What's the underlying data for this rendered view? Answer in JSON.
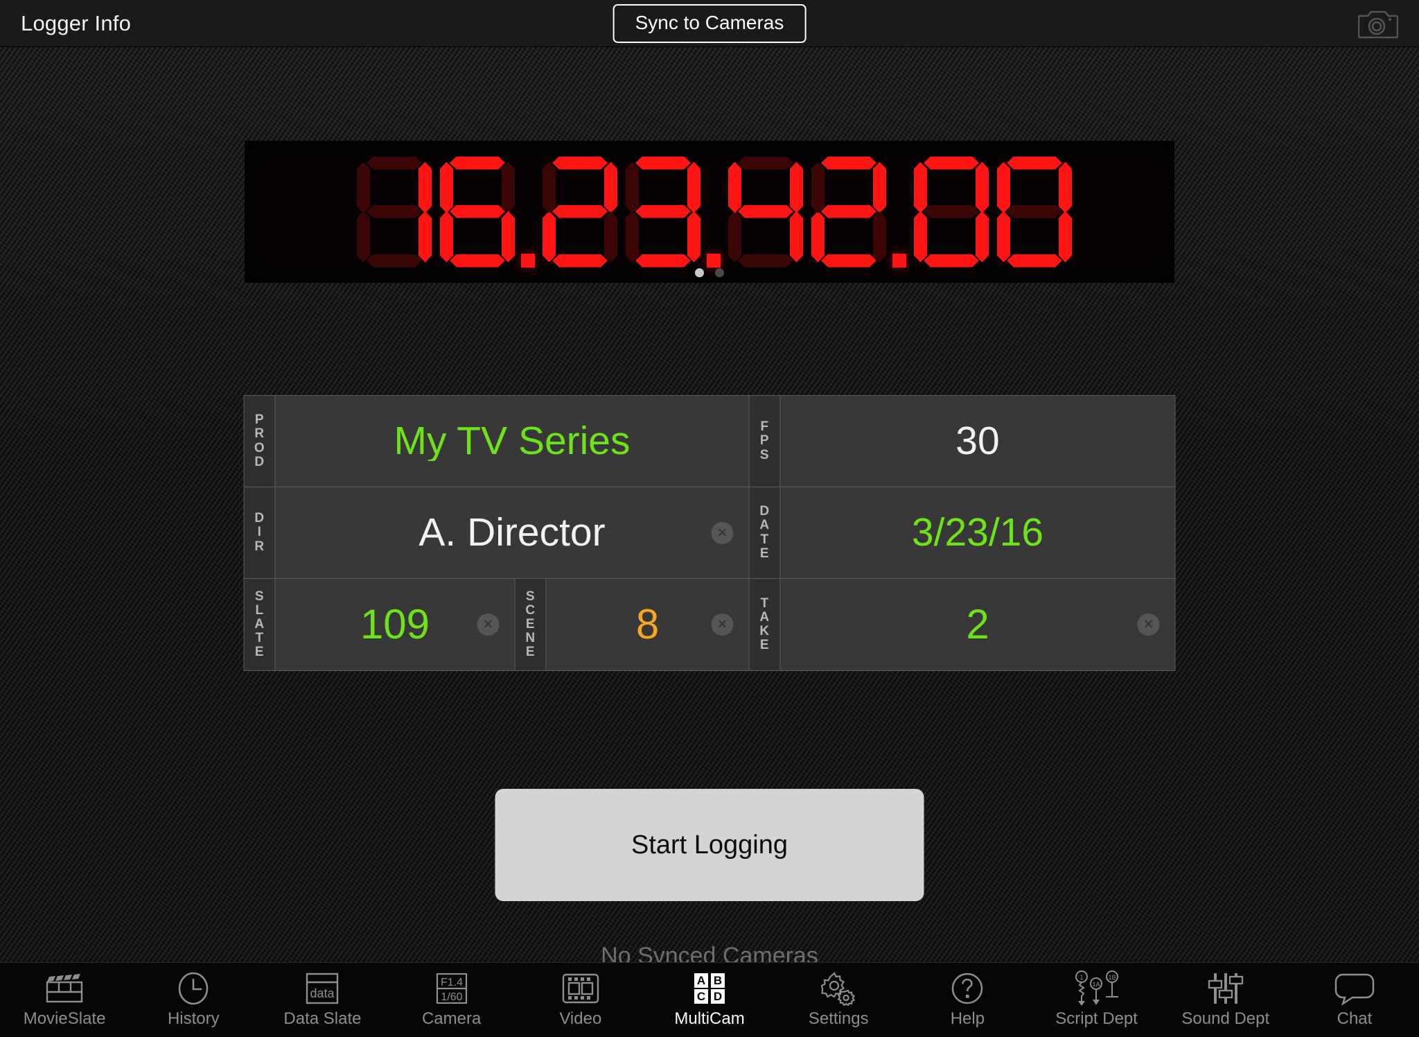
{
  "topbar": {
    "title": "Logger Info",
    "sync_button": "Sync to Cameras",
    "camera_icon": "camera-icon"
  },
  "timecode": {
    "value": "16.23.42.00",
    "digits": [
      "1",
      "6",
      ".",
      "2",
      "3",
      ".",
      "4",
      "2",
      ".",
      "0",
      "0"
    ],
    "color": "#ff1414",
    "pages": 2,
    "active_page": 1
  },
  "slate": {
    "rows": [
      {
        "left_label": "PROD",
        "left_value": "My TV Series",
        "left_color": "#6fe319",
        "left_clear": false,
        "right_label": "FPS",
        "right_value": "30",
        "right_color": "#f2f2f2",
        "right_clear": false
      },
      {
        "left_label": "DIR",
        "left_value": "A. Director",
        "left_color": "#f2f2f2",
        "left_clear": true,
        "right_label": "DATE",
        "right_value": "3/23/16",
        "right_color": "#6fe319",
        "right_clear": false
      }
    ],
    "bottom_row": {
      "slate_label": "SLATE",
      "slate_value": "109",
      "slate_color": "#6fe319",
      "scene_label": "SCENE",
      "scene_value": "8",
      "scene_color": "#f5a623",
      "take_label": "TAKE",
      "take_value": "2",
      "take_color": "#6fe319"
    },
    "clear_glyph": "×"
  },
  "actions": {
    "start_logging": "Start Logging",
    "sync_status": "No Synced Cameras"
  },
  "tabbar": {
    "active_index": 5,
    "items": [
      {
        "label": "MovieSlate",
        "icon": "clapperboard-icon"
      },
      {
        "label": "History",
        "icon": "clock-icon"
      },
      {
        "label": "Data Slate",
        "icon": "data-slate-icon",
        "icon_text": "data"
      },
      {
        "label": "Camera",
        "icon": "camera-settings-icon",
        "icon_text_top": "F1.4",
        "icon_text_bottom": "1/60"
      },
      {
        "label": "Video",
        "icon": "film-strip-icon"
      },
      {
        "label": "MultiCam",
        "icon": "multicam-abcd-icon",
        "icon_letters": [
          "A",
          "B",
          "C",
          "D"
        ]
      },
      {
        "label": "Settings",
        "icon": "gear-icon"
      },
      {
        "label": "Help",
        "icon": "question-circle-icon"
      },
      {
        "label": "Script Dept",
        "icon": "script-lining-icon",
        "icon_text": [
          "1",
          "1A",
          "1B"
        ]
      },
      {
        "label": "Sound Dept",
        "icon": "mixer-faders-icon"
      },
      {
        "label": "Chat",
        "icon": "speech-bubble-icon"
      }
    ]
  }
}
